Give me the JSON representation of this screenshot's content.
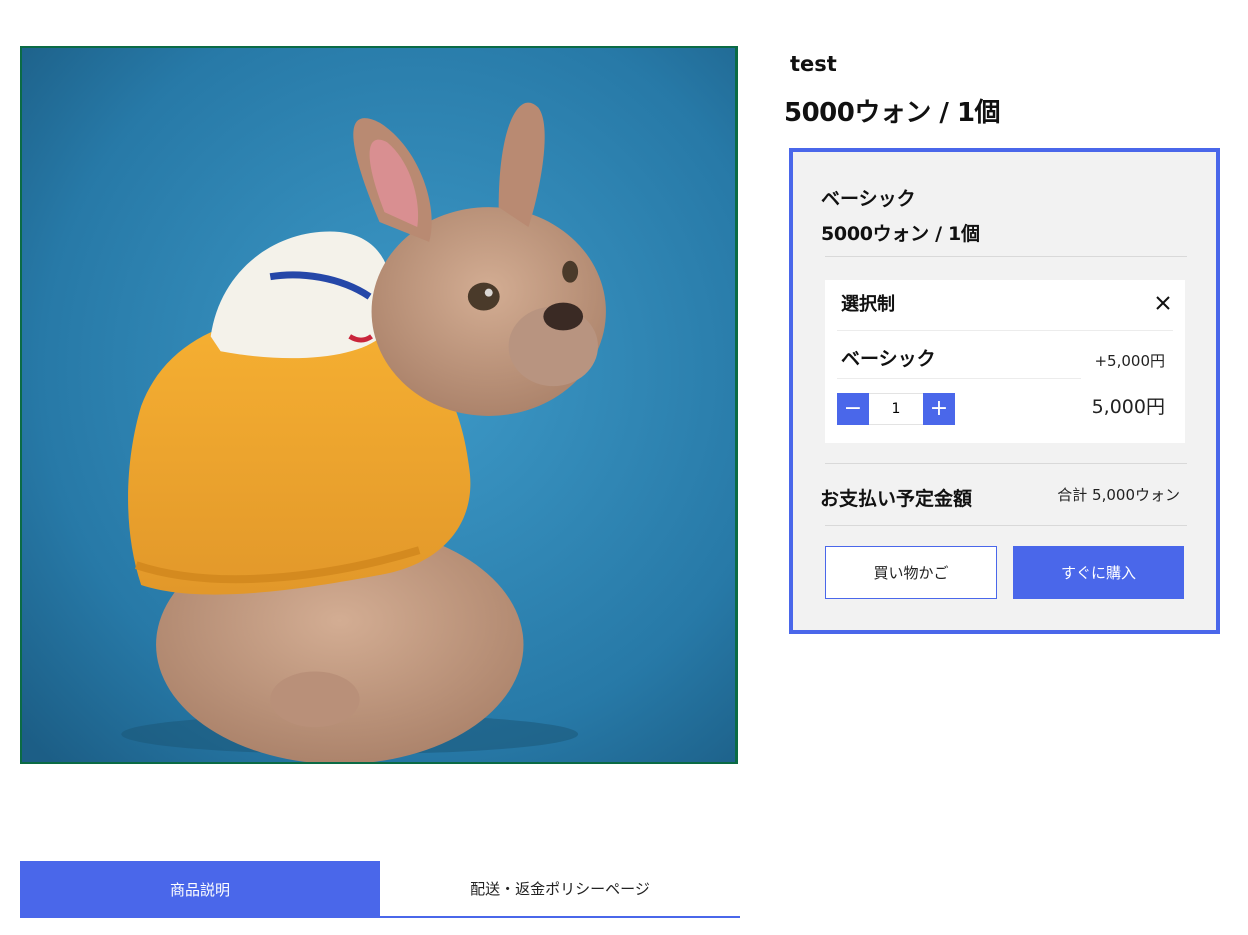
{
  "product": {
    "title": "test",
    "price": "5000ウォン / 1個",
    "image_name": "french-bulldog-in-yellow-hoodie-photo"
  },
  "option_panel": {
    "option_name": "ベーシック",
    "option_price": "5000ウォン / 1個",
    "selected": {
      "header": "選択制",
      "option_label": "ベーシック",
      "option_extra": "+5,000円",
      "quantity": "1",
      "subtotal": "5,000円"
    },
    "payment_label": "お支払い予定金額",
    "payment_total": "合計 5,000ウォン",
    "cart_button": "買い物かご",
    "buy_button": "すぐに購入"
  },
  "tabs": [
    {
      "label": "商品説明",
      "active": true
    },
    {
      "label": "配送・返金ポリシーページ",
      "active": false
    }
  ],
  "colors": {
    "accent": "#4a67ea",
    "panel_bg": "#f2f2f2",
    "image_border": "#0b6b45"
  },
  "icons": {
    "close": "close-icon",
    "minus": "minus-icon",
    "plus": "plus-icon"
  }
}
